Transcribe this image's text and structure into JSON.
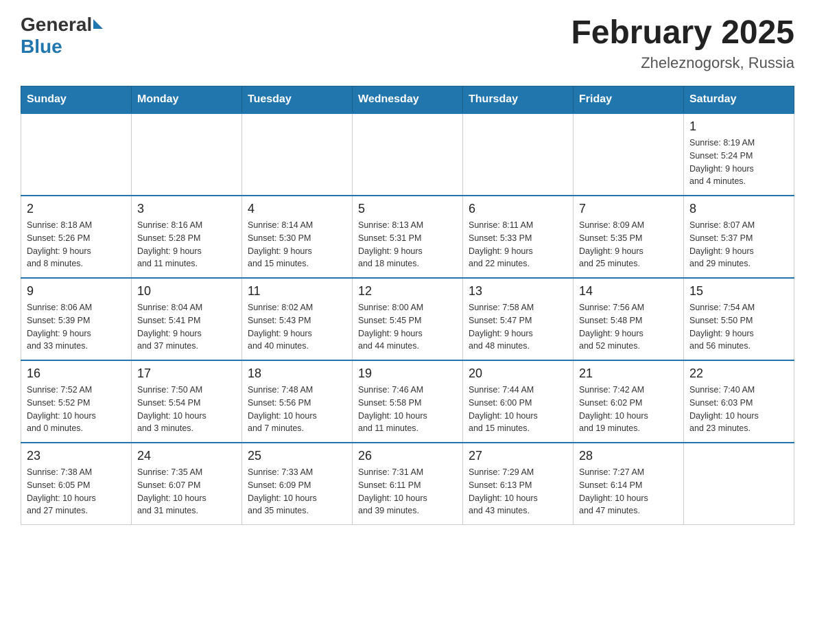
{
  "header": {
    "logo_general": "General",
    "logo_blue": "Blue",
    "month": "February 2025",
    "location": "Zheleznogorsk, Russia"
  },
  "weekdays": [
    "Sunday",
    "Monday",
    "Tuesday",
    "Wednesday",
    "Thursday",
    "Friday",
    "Saturday"
  ],
  "weeks": [
    [
      {
        "day": "",
        "info": ""
      },
      {
        "day": "",
        "info": ""
      },
      {
        "day": "",
        "info": ""
      },
      {
        "day": "",
        "info": ""
      },
      {
        "day": "",
        "info": ""
      },
      {
        "day": "",
        "info": ""
      },
      {
        "day": "1",
        "info": "Sunrise: 8:19 AM\nSunset: 5:24 PM\nDaylight: 9 hours\nand 4 minutes."
      }
    ],
    [
      {
        "day": "2",
        "info": "Sunrise: 8:18 AM\nSunset: 5:26 PM\nDaylight: 9 hours\nand 8 minutes."
      },
      {
        "day": "3",
        "info": "Sunrise: 8:16 AM\nSunset: 5:28 PM\nDaylight: 9 hours\nand 11 minutes."
      },
      {
        "day": "4",
        "info": "Sunrise: 8:14 AM\nSunset: 5:30 PM\nDaylight: 9 hours\nand 15 minutes."
      },
      {
        "day": "5",
        "info": "Sunrise: 8:13 AM\nSunset: 5:31 PM\nDaylight: 9 hours\nand 18 minutes."
      },
      {
        "day": "6",
        "info": "Sunrise: 8:11 AM\nSunset: 5:33 PM\nDaylight: 9 hours\nand 22 minutes."
      },
      {
        "day": "7",
        "info": "Sunrise: 8:09 AM\nSunset: 5:35 PM\nDaylight: 9 hours\nand 25 minutes."
      },
      {
        "day": "8",
        "info": "Sunrise: 8:07 AM\nSunset: 5:37 PM\nDaylight: 9 hours\nand 29 minutes."
      }
    ],
    [
      {
        "day": "9",
        "info": "Sunrise: 8:06 AM\nSunset: 5:39 PM\nDaylight: 9 hours\nand 33 minutes."
      },
      {
        "day": "10",
        "info": "Sunrise: 8:04 AM\nSunset: 5:41 PM\nDaylight: 9 hours\nand 37 minutes."
      },
      {
        "day": "11",
        "info": "Sunrise: 8:02 AM\nSunset: 5:43 PM\nDaylight: 9 hours\nand 40 minutes."
      },
      {
        "day": "12",
        "info": "Sunrise: 8:00 AM\nSunset: 5:45 PM\nDaylight: 9 hours\nand 44 minutes."
      },
      {
        "day": "13",
        "info": "Sunrise: 7:58 AM\nSunset: 5:47 PM\nDaylight: 9 hours\nand 48 minutes."
      },
      {
        "day": "14",
        "info": "Sunrise: 7:56 AM\nSunset: 5:48 PM\nDaylight: 9 hours\nand 52 minutes."
      },
      {
        "day": "15",
        "info": "Sunrise: 7:54 AM\nSunset: 5:50 PM\nDaylight: 9 hours\nand 56 minutes."
      }
    ],
    [
      {
        "day": "16",
        "info": "Sunrise: 7:52 AM\nSunset: 5:52 PM\nDaylight: 10 hours\nand 0 minutes."
      },
      {
        "day": "17",
        "info": "Sunrise: 7:50 AM\nSunset: 5:54 PM\nDaylight: 10 hours\nand 3 minutes."
      },
      {
        "day": "18",
        "info": "Sunrise: 7:48 AM\nSunset: 5:56 PM\nDaylight: 10 hours\nand 7 minutes."
      },
      {
        "day": "19",
        "info": "Sunrise: 7:46 AM\nSunset: 5:58 PM\nDaylight: 10 hours\nand 11 minutes."
      },
      {
        "day": "20",
        "info": "Sunrise: 7:44 AM\nSunset: 6:00 PM\nDaylight: 10 hours\nand 15 minutes."
      },
      {
        "day": "21",
        "info": "Sunrise: 7:42 AM\nSunset: 6:02 PM\nDaylight: 10 hours\nand 19 minutes."
      },
      {
        "day": "22",
        "info": "Sunrise: 7:40 AM\nSunset: 6:03 PM\nDaylight: 10 hours\nand 23 minutes."
      }
    ],
    [
      {
        "day": "23",
        "info": "Sunrise: 7:38 AM\nSunset: 6:05 PM\nDaylight: 10 hours\nand 27 minutes."
      },
      {
        "day": "24",
        "info": "Sunrise: 7:35 AM\nSunset: 6:07 PM\nDaylight: 10 hours\nand 31 minutes."
      },
      {
        "day": "25",
        "info": "Sunrise: 7:33 AM\nSunset: 6:09 PM\nDaylight: 10 hours\nand 35 minutes."
      },
      {
        "day": "26",
        "info": "Sunrise: 7:31 AM\nSunset: 6:11 PM\nDaylight: 10 hours\nand 39 minutes."
      },
      {
        "day": "27",
        "info": "Sunrise: 7:29 AM\nSunset: 6:13 PM\nDaylight: 10 hours\nand 43 minutes."
      },
      {
        "day": "28",
        "info": "Sunrise: 7:27 AM\nSunset: 6:14 PM\nDaylight: 10 hours\nand 47 minutes."
      },
      {
        "day": "",
        "info": ""
      }
    ]
  ]
}
